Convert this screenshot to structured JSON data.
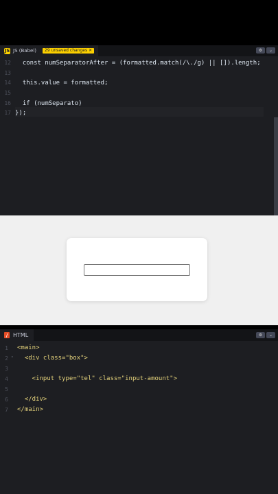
{
  "js_panel": {
    "tab_logo": "JS",
    "tab_label": "JS (Babel)",
    "unsaved_badge": "29 unsaved changes",
    "badge_close": "✕",
    "settings_icon": "⚙",
    "collapse_icon": "⌄",
    "lines": [
      {
        "num": "12",
        "code": "  const numSeparatorAfter = (formatted.match(/\\./g) || []).length;"
      },
      {
        "num": "13",
        "code": ""
      },
      {
        "num": "14",
        "code": "  this.value = formatted;"
      },
      {
        "num": "15",
        "code": ""
      },
      {
        "num": "16",
        "code": "  if (numSeparato)"
      },
      {
        "num": "17",
        "code": "});"
      }
    ]
  },
  "html_panel": {
    "tab_logo": "/",
    "tab_label": "HTML",
    "settings_icon": "⚙",
    "collapse_icon": "⌄",
    "lines": [
      {
        "num": "1",
        "code": "<main>"
      },
      {
        "num": "2",
        "code": "  <div class=\"box\">"
      },
      {
        "num": "3",
        "code": ""
      },
      {
        "num": "4",
        "code": "    <input type=\"tel\" class=\"input-amount\">"
      },
      {
        "num": "5",
        "code": ""
      },
      {
        "num": "6",
        "code": "  </div>"
      },
      {
        "num": "7",
        "code": "</main>"
      }
    ]
  },
  "colors": {
    "editor_bg": "#1d1e22",
    "header_bg": "#131417",
    "js_accent": "#fcd000",
    "html_accent": "#e44d26"
  }
}
